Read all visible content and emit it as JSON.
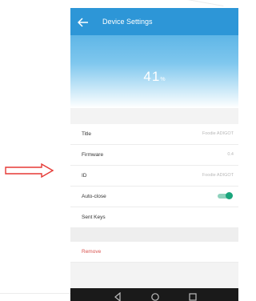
{
  "screen": {
    "title": "Device Settings",
    "battery_value": "41",
    "battery_unit": "%"
  },
  "settings": [
    {
      "label": "Title",
      "value": "Foodie ADIGOT"
    },
    {
      "label": "Firmware",
      "value": "0.4"
    },
    {
      "label": "ID",
      "value": "Foodie ADIGOT"
    },
    {
      "label": "Auto-close",
      "toggle": true
    },
    {
      "label": "Sent Keys"
    }
  ],
  "remove_label": "Remove",
  "colors": {
    "header_blue": "#2d96d7",
    "toggle_green": "#1aa57c",
    "remove_red": "#d9534f",
    "arrow_red": "#e53935"
  },
  "icons": {
    "back": "back-arrow-icon",
    "pointer": "pointer-arrow-icon",
    "nav_back": "nav-back-icon",
    "nav_home": "nav-home-icon",
    "nav_recents": "nav-recents-icon"
  }
}
